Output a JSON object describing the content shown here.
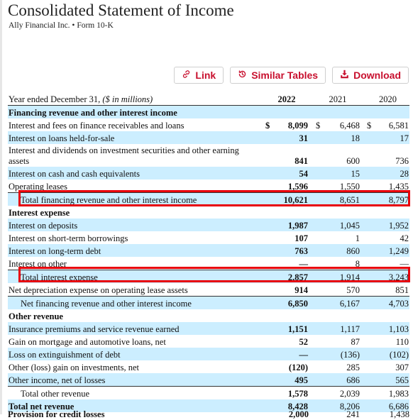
{
  "header": {
    "title": "Consolidated Statement of Income",
    "subtitle": "Ally Financial Inc. • Form 10-K"
  },
  "toolbar": {
    "link_label": "Link",
    "similar_label": "Similar Tables",
    "download_label": "Download",
    "accent_color": "#c8102e"
  },
  "table": {
    "header_label": "Year ended December 31,",
    "header_unit": "($ in millions)",
    "columns": [
      "2022",
      "2021",
      "2020"
    ],
    "rows": [
      {
        "label": "Financing revenue and other interest income",
        "type": "section",
        "values": [
          "",
          "",
          ""
        ]
      },
      {
        "label": "Interest and fees on finance receivables and loans",
        "values": [
          "8,099",
          "6,468",
          "6,581"
        ],
        "currency": "$"
      },
      {
        "label": "Interest on loans held-for-sale",
        "values": [
          "31",
          "18",
          "17"
        ]
      },
      {
        "label": "Interest and dividends on investment securities and other earning assets",
        "values": [
          "841",
          "600",
          "736"
        ]
      },
      {
        "label": "Interest on cash and cash equivalents",
        "values": [
          "54",
          "15",
          "28"
        ]
      },
      {
        "label": "Operating leases",
        "values": [
          "1,596",
          "1,550",
          "1,435"
        ]
      },
      {
        "label": "Total financing revenue and other interest income",
        "type": "total",
        "highlighted": true,
        "values": [
          "10,621",
          "8,651",
          "8,797"
        ]
      },
      {
        "label": "Interest expense",
        "type": "section",
        "values": [
          "",
          "",
          ""
        ]
      },
      {
        "label": "Interest on deposits",
        "values": [
          "1,987",
          "1,045",
          "1,952"
        ]
      },
      {
        "label": "Interest on short-term borrowings",
        "values": [
          "107",
          "1",
          "42"
        ]
      },
      {
        "label": "Interest on long-term debt",
        "values": [
          "763",
          "860",
          "1,249"
        ]
      },
      {
        "label": "Interest on other",
        "values": [
          "—",
          "8",
          "—"
        ]
      },
      {
        "label": "Total interest expense",
        "type": "total",
        "highlighted": true,
        "values": [
          "2,857",
          "1,914",
          "3,243"
        ]
      },
      {
        "label": "Net depreciation expense on operating lease assets",
        "values": [
          "914",
          "570",
          "851"
        ]
      },
      {
        "label": "Net financing revenue and other interest income",
        "type": "subtotal",
        "values": [
          "6,850",
          "6,167",
          "4,703"
        ]
      },
      {
        "label": "Other revenue",
        "type": "section",
        "values": [
          "",
          "",
          ""
        ]
      },
      {
        "label": "Insurance premiums and service revenue earned",
        "values": [
          "1,151",
          "1,117",
          "1,103"
        ]
      },
      {
        "label": "Gain on mortgage and automotive loans, net",
        "values": [
          "52",
          "87",
          "110"
        ]
      },
      {
        "label": "Loss on extinguishment of debt",
        "values": [
          "—",
          "(136)",
          "(102)"
        ]
      },
      {
        "label": "Other (loss) gain on investments, net",
        "values": [
          "(120)",
          "285",
          "307"
        ]
      },
      {
        "label": "Other income, net of losses",
        "values": [
          "495",
          "686",
          "565"
        ]
      },
      {
        "label": "Total other revenue",
        "type": "total",
        "values": [
          "1,578",
          "2,039",
          "1,983"
        ]
      },
      {
        "label": "Total net revenue",
        "type": "grand",
        "values": [
          "8,428",
          "8,206",
          "6,686"
        ]
      }
    ],
    "clipped_row": {
      "label": "Provision for credit losses",
      "values": [
        "2,000",
        "241",
        "1,438"
      ]
    }
  }
}
